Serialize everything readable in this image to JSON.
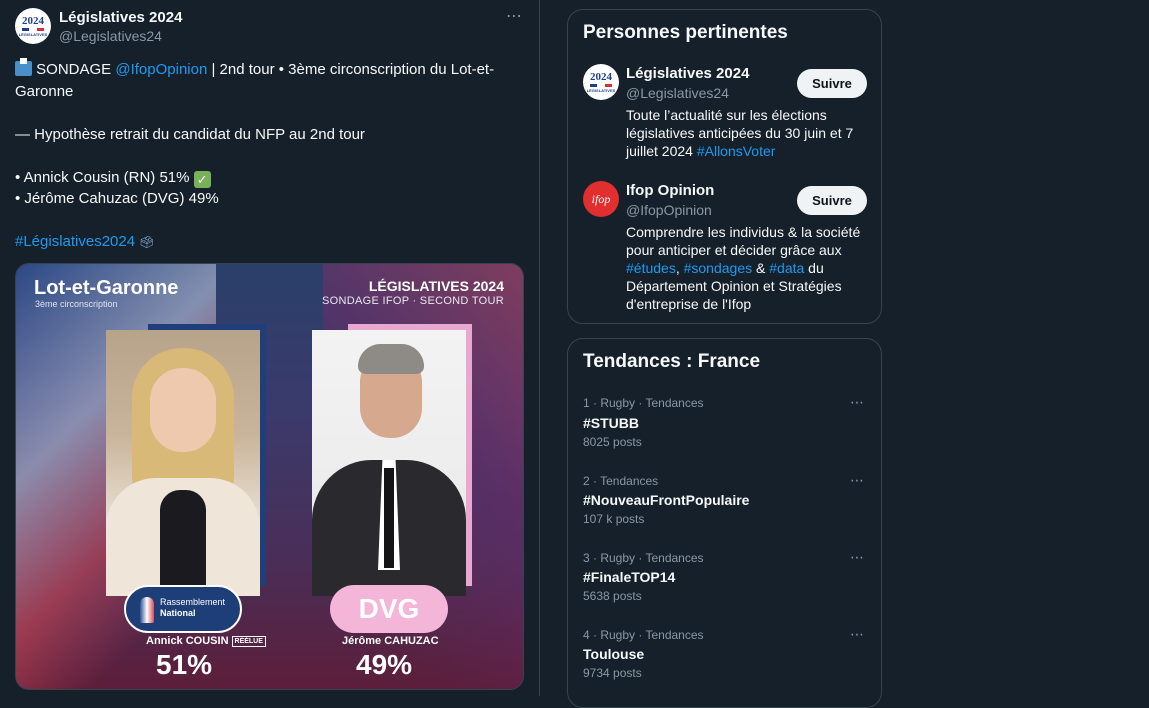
{
  "tweet": {
    "author_name": "Législatives 2024",
    "author_handle": "@Legislatives24",
    "more_icon": "⋯",
    "line1_prefix": "SONDAGE ",
    "line1_mention": "@IfopOpinion",
    "line1_suffix": " | 2nd tour • 3ème circonscription du Lot-et-",
    "line2": "Garonne",
    "line3": "— Hypothèse retrait du candidat du NFP au 2nd tour",
    "line4": "• Annick Cousin (RN) 51% ",
    "line5": "• Jérôme Cahuzac (DVG) 49%",
    "hashtag": "#Législatives2024",
    "logo": {
      "year": "2024",
      "text": "LÉGISLATIVES"
    }
  },
  "media": {
    "region": "Lot-et-Garonne",
    "circonscription": "3ème circonscription",
    "title": "LÉGISLATIVES 2024",
    "subtitle": "SONDAGE IFOP · SECOND TOUR",
    "candidate_left": {
      "party_top": "Rassemblement",
      "party_bottom": "National",
      "name": "Annick COUSIN",
      "tag": "RÉÉLUE",
      "percent": "51%"
    },
    "candidate_right": {
      "party": "DVG",
      "name": "Jérôme CAHUZAC",
      "percent": "49%"
    }
  },
  "sidebar": {
    "people_title": "Personnes pertinentes",
    "people": [
      {
        "name": "Législatives 2024",
        "handle": "@Legislatives24",
        "follow_label": "Suivre",
        "bio_text": "Toute l’actualité sur les élections législatives anticipées du 30 juin et 7 juillet 2024 ",
        "bio_link": "#AllonsVoter"
      },
      {
        "name": "Ifop Opinion",
        "handle": "@IfopOpinion",
        "follow_label": "Suivre",
        "avatar_text": "ifop",
        "bio_1": "Comprendre les individus & la société pour anticiper et décider grâce aux ",
        "bio_link1": "#études",
        "bio_sep1": ", ",
        "bio_link2": "#sondages",
        "bio_sep2": " & ",
        "bio_link3": "#data",
        "bio_2": " du Département Opinion et Stratégies d'entreprise de l'Ifop"
      }
    ],
    "trends_title": "Tendances : France",
    "trends": [
      {
        "meta": "1 · Rugby · Tendances",
        "name": "#STUBB",
        "count": "8025 posts"
      },
      {
        "meta": "2 · Tendances",
        "name": "#NouveauFrontPopulaire",
        "count": "107 k posts"
      },
      {
        "meta": "3 · Rugby · Tendances",
        "name": "#FinaleTOP14",
        "count": "5638 posts"
      },
      {
        "meta": "4 · Rugby · Tendances",
        "name": "Toulouse",
        "count": "9734 posts"
      }
    ],
    "more_icon": "⋯"
  },
  "colors": {
    "background": "#15202b",
    "link": "#1d9bf0",
    "muted": "#8b98a5",
    "border": "#38444d",
    "rn_blue": "#1e3e78",
    "dvg_pink": "#f4b6d8"
  }
}
